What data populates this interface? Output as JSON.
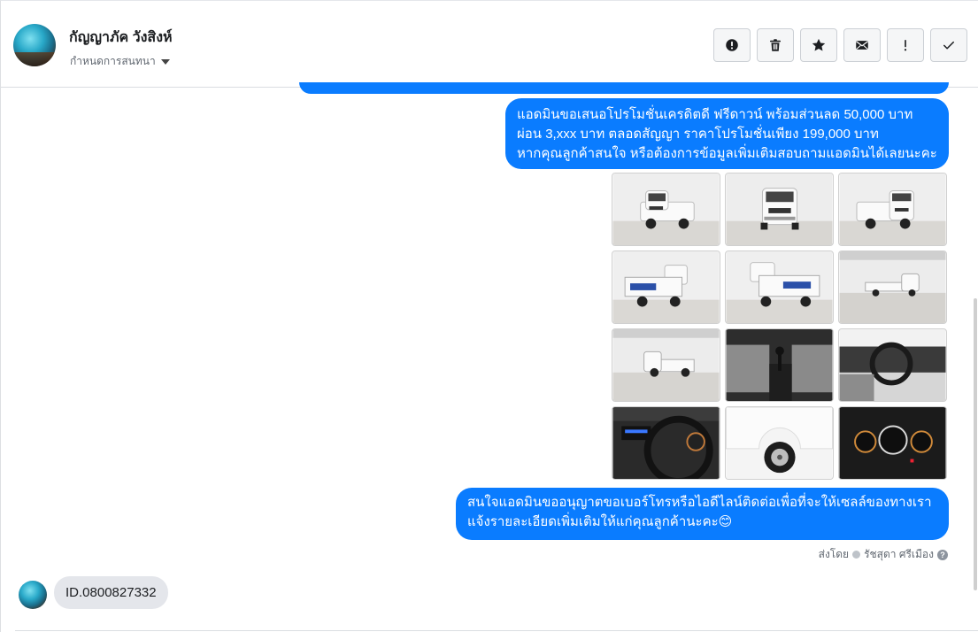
{
  "header": {
    "contact_name": "กัญญาภัค วังสิงห์",
    "assign_label": "กำหนดการสนทนา"
  },
  "toolbar": {
    "buttons": [
      {
        "name": "spam-button",
        "icon": "alert-circle-icon"
      },
      {
        "name": "delete-button",
        "icon": "trash-icon"
      },
      {
        "name": "star-button",
        "icon": "star-icon"
      },
      {
        "name": "mark-unread-button",
        "icon": "envelope-icon"
      },
      {
        "name": "follow-up-button",
        "icon": "exclamation-icon"
      },
      {
        "name": "done-button",
        "icon": "check-icon"
      }
    ]
  },
  "messages": {
    "promo_lines": [
      "แอดมินขอเสนอโปรโมชั่นเครดิตดี ฟรีดาวน์ พร้อมส่วนลด 50,000 บาท",
      "ผ่อน 3,xxx บาท ตลอดสัญญา ราคาโปรโมชั่นเพียง 199,000 บาท",
      "หากคุณลูกค้าสนใจ หรือต้องการข้อมูลเพิ่มเติมสอบถามแอดมินได้เลยนะคะ"
    ],
    "request_lines": [
      "สนใจแอดมินขออนุญาตขอเบอร์โทรหรือไอดีไลน์ติดต่อเพื่อที่จะให้เซลล์ของทางเรา",
      "แจ้งรายละเอียดเพิ่มเติมให้แก่คุณลูกค้านะคะ😊"
    ],
    "sent_by_label": "ส่งโดย",
    "sent_by_name": "รัชสุดา ศรีเมือง",
    "incoming_text": "ID.0800827332"
  },
  "photos": [
    {
      "name": "truck-front-left"
    },
    {
      "name": "truck-front"
    },
    {
      "name": "truck-front-right"
    },
    {
      "name": "truck-rear-left-suzuki"
    },
    {
      "name": "truck-rear-right-suzuki"
    },
    {
      "name": "truck-side-right"
    },
    {
      "name": "truck-side-left"
    },
    {
      "name": "seat-gear-lever"
    },
    {
      "name": "dashboard-steering"
    },
    {
      "name": "steering-gauges"
    },
    {
      "name": "wheel-closeup"
    },
    {
      "name": "instrument-cluster"
    }
  ]
}
